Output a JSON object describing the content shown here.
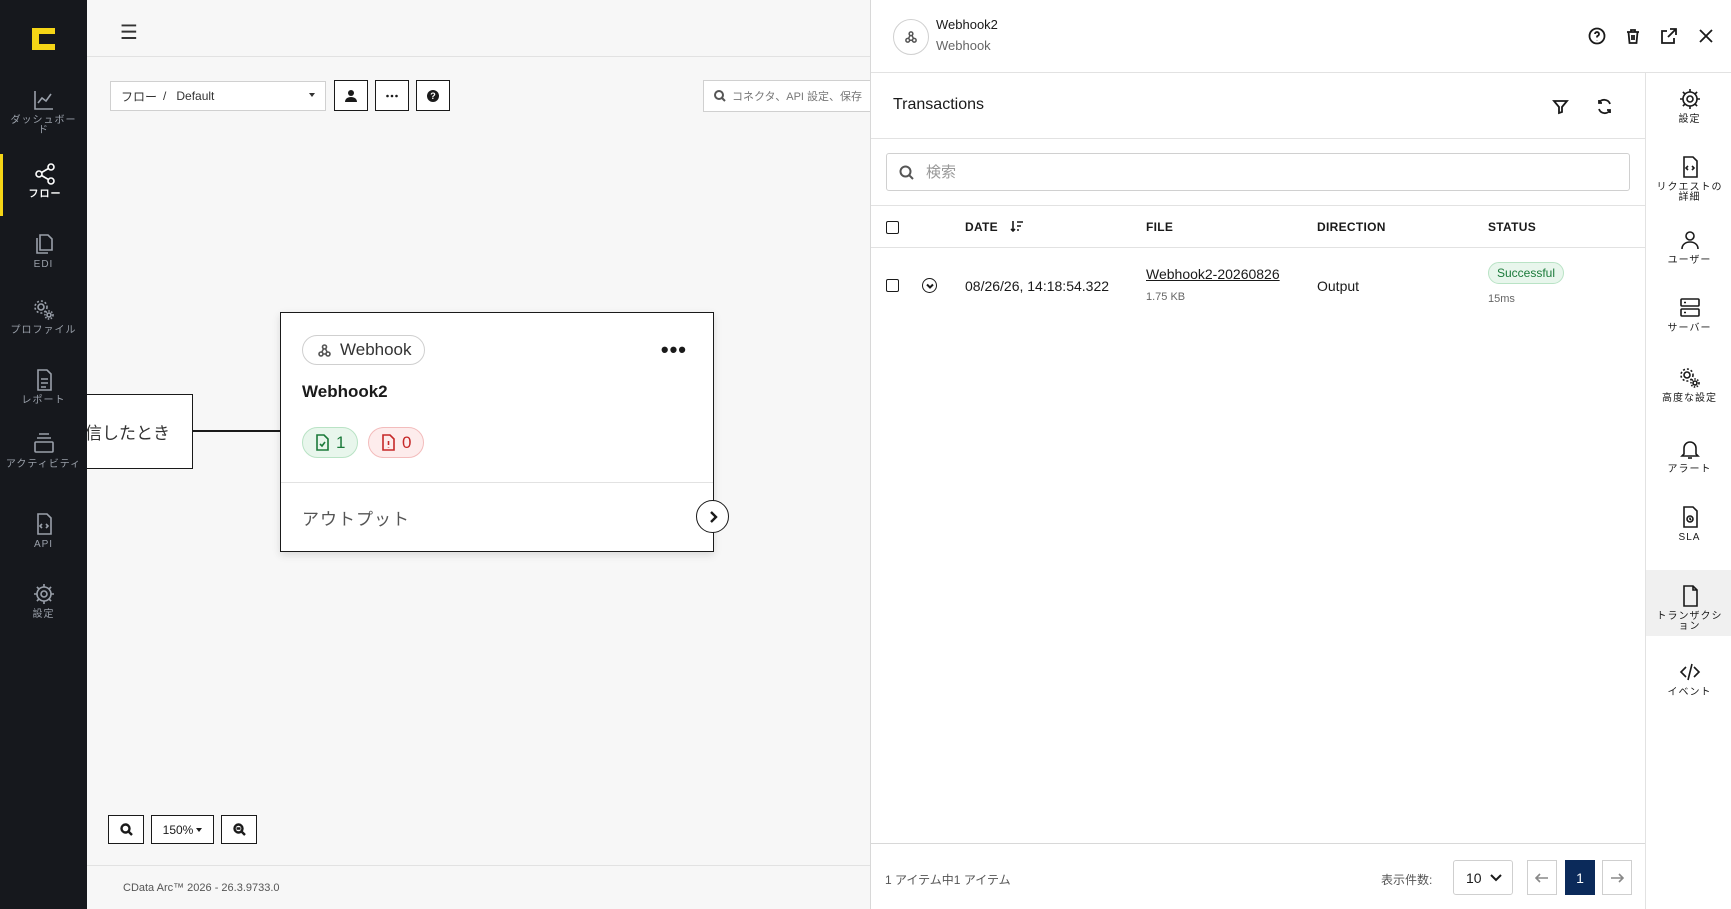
{
  "nav": {
    "items": [
      {
        "label": "ダッシュボード",
        "icon": "chart-line-icon"
      },
      {
        "label": "フロー",
        "icon": "share-nodes-icon",
        "active": true
      },
      {
        "label": "EDI",
        "icon": "files-icon"
      },
      {
        "label": "プロファイル",
        "icon": "gears-icon"
      },
      {
        "label": "レポート",
        "icon": "document-icon"
      },
      {
        "label": "アクティビティ",
        "icon": "layers-icon"
      },
      {
        "label": "API",
        "icon": "code-file-icon"
      },
      {
        "label": "設定",
        "icon": "gear-icon"
      }
    ]
  },
  "canvas": {
    "breadcrumb_root": "フロー",
    "breadcrumb_sep": "/",
    "breadcrumb_value": "Default",
    "search_placeholder": "コネクタ、API 設定、保存",
    "prev_node_text": "信したとき",
    "node": {
      "type": "Webhook",
      "title": "Webhook2",
      "success_count": "1",
      "error_count": "0",
      "output_label": "アウトプット"
    },
    "zoom_level": "150%",
    "footer": "CData Arc™ 2026 - 26.3.9733.0"
  },
  "panel": {
    "title": "Webhook2",
    "subtitle": "Webhook",
    "section_title": "Transactions",
    "search_placeholder": "検索",
    "columns": {
      "date": "DATE",
      "file": "FILE",
      "direction": "DIRECTION",
      "status": "STATUS"
    },
    "rows": [
      {
        "date": "08/26/26, 14:18:54.322",
        "file": "Webhook2-20260826",
        "file_size": "1.75 KB",
        "direction": "Output",
        "status": "Successful",
        "duration": "15ms"
      }
    ],
    "footer": {
      "summary": "1 アイテム中1 アイテム",
      "per_page_label": "表示件数:",
      "per_page_value": "10",
      "current_page": "1"
    }
  },
  "right_menu": {
    "items": [
      {
        "label": "設定",
        "icon": "gear-icon"
      },
      {
        "label": "リクエストの詳細",
        "icon": "request-file-icon"
      },
      {
        "label": "ユーザー",
        "icon": "user-icon"
      },
      {
        "label": "サーバー",
        "icon": "server-icon"
      },
      {
        "label": "高度な設定",
        "icon": "gears-icon"
      },
      {
        "label": "アラート",
        "icon": "bell-icon"
      },
      {
        "label": "SLA",
        "icon": "sla-file-icon"
      },
      {
        "label": "トランザクション",
        "icon": "file-icon",
        "active": true
      },
      {
        "label": "イベント",
        "icon": "code-icon"
      }
    ]
  },
  "colors": {
    "accent": "#f5d516",
    "nav_bg": "#16181d",
    "success": "#1b7a3a",
    "error": "#c62828",
    "page_active": "#0b2a5a"
  }
}
